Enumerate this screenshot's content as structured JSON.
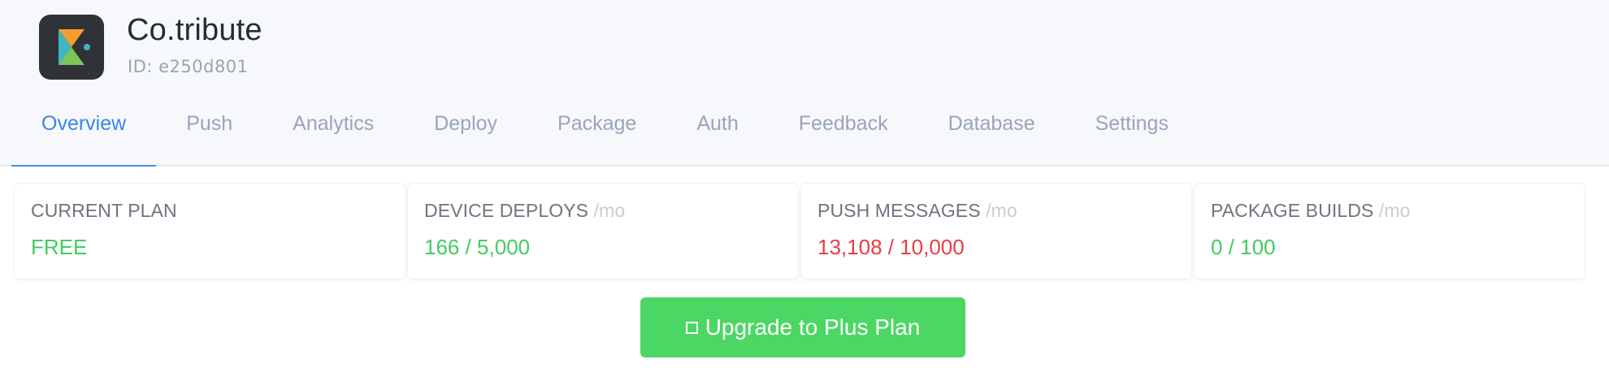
{
  "app": {
    "name": "Co.tribute",
    "id_text": "ID: e250d801",
    "icon": "app-logo-icon"
  },
  "tabs": [
    {
      "label": "Overview",
      "active": true
    },
    {
      "label": "Push",
      "active": false
    },
    {
      "label": "Analytics",
      "active": false
    },
    {
      "label": "Deploy",
      "active": false
    },
    {
      "label": "Package",
      "active": false
    },
    {
      "label": "Auth",
      "active": false
    },
    {
      "label": "Feedback",
      "active": false
    },
    {
      "label": "Database",
      "active": false
    },
    {
      "label": "Settings",
      "active": false
    }
  ],
  "usage": {
    "current_plan": {
      "label": "CURRENT PLAN",
      "unit": "",
      "value": "FREE",
      "status": "ok"
    },
    "device_deploys": {
      "label": "DEVICE DEPLOYS",
      "unit": "/mo",
      "value": "166 / 5,000",
      "status": "ok"
    },
    "push_messages": {
      "label": "PUSH MESSAGES",
      "unit": "/mo",
      "value": "13,108 / 10,000",
      "status": "over"
    },
    "package_builds": {
      "label": "PACKAGE BUILDS",
      "unit": "/mo",
      "value": "0 / 100",
      "status": "ok"
    }
  },
  "upgrade_button": {
    "label": "Upgrade to Plus Plan",
    "icon": "square-icon"
  },
  "colors": {
    "accent": "#3a86e8",
    "ok": "#43cc5e",
    "over": "#ea3b45",
    "button": "#4cd765"
  }
}
